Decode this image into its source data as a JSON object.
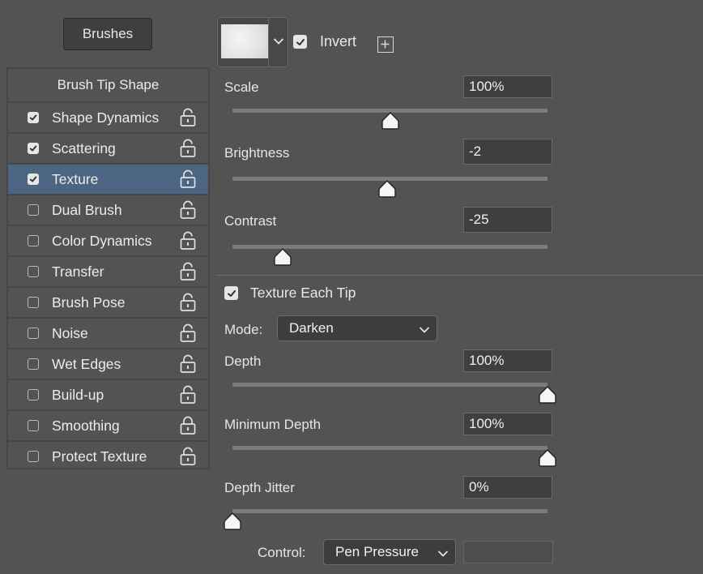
{
  "brushes_button": "Brushes",
  "list": {
    "header": "Brush Tip Shape",
    "items": [
      {
        "label": "Shape Dynamics",
        "checked": true
      },
      {
        "label": "Scattering",
        "checked": true
      },
      {
        "label": "Texture",
        "checked": true,
        "selected": true
      },
      {
        "label": "Dual Brush",
        "checked": false
      },
      {
        "label": "Color Dynamics",
        "checked": false
      },
      {
        "label": "Transfer",
        "checked": false
      },
      {
        "label": "Brush Pose",
        "checked": false
      },
      {
        "label": "Noise",
        "checked": false
      },
      {
        "label": "Wet Edges",
        "checked": false
      },
      {
        "label": "Build-up",
        "checked": false
      },
      {
        "label": "Smoothing",
        "checked": false,
        "locked": true
      },
      {
        "label": "Protect Texture",
        "checked": false
      }
    ]
  },
  "texture": {
    "invert_label": "Invert",
    "invert_checked": true,
    "scale": {
      "label": "Scale",
      "value": "100%",
      "level": 0.5
    },
    "brightness": {
      "label": "Brightness",
      "value": "-2",
      "level": 0.49
    },
    "contrast": {
      "label": "Contrast",
      "value": "-25",
      "level": 0.16
    },
    "texture_each_tip": {
      "label": "Texture Each Tip",
      "checked": true
    },
    "mode": {
      "label": "Mode:",
      "value": "Darken"
    },
    "depth": {
      "label": "Depth",
      "value": "100%",
      "level": 1.0
    },
    "minimum_depth": {
      "label": "Minimum Depth",
      "value": "100%",
      "level": 1.0
    },
    "depth_jitter": {
      "label": "Depth Jitter",
      "value": "0%",
      "level": 0.0
    },
    "control": {
      "label": "Control:",
      "value": "Pen Pressure"
    }
  },
  "colors": {
    "panel_bg": "#535353",
    "selected_row": "#4b6583",
    "field_bg": "#3f3f3f"
  },
  "icons": [
    "unlocked-icon",
    "locked-icon",
    "checkmark-icon",
    "chevron-down-icon",
    "plus-icon",
    "slider-thumb-icon"
  ]
}
